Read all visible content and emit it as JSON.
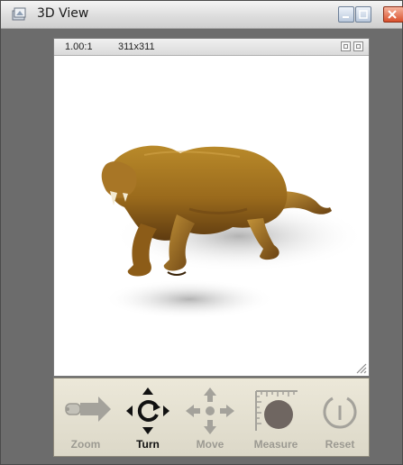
{
  "window": {
    "title": "3D View"
  },
  "viewer": {
    "zoom_ratio": "1.00:1",
    "dimensions": "311x311"
  },
  "toolbar": {
    "tools": [
      {
        "label": "Zoom",
        "icon": "zoom-slider-icon"
      },
      {
        "label": "Turn",
        "icon": "rotate-arrows-icon",
        "selected": true
      },
      {
        "label": "Move",
        "icon": "move-arrows-icon"
      },
      {
        "label": "Measure",
        "icon": "measure-icon"
      },
      {
        "label": "Reset",
        "icon": "reset-power-icon"
      }
    ]
  },
  "colors": {
    "inactive_label": "#9c9a92",
    "active_label": "#111111",
    "close_button": "#d9502c"
  }
}
